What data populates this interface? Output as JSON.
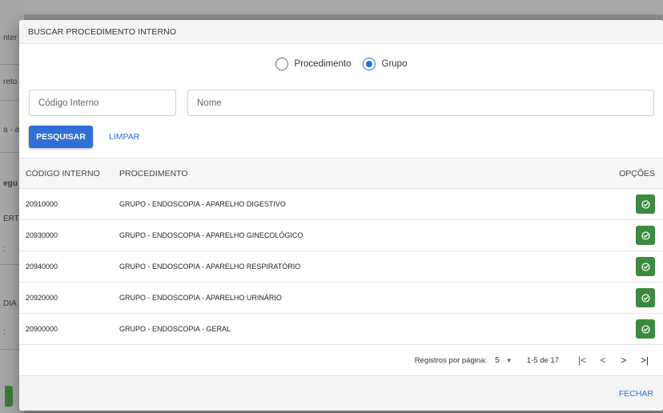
{
  "background": {
    "fragments": [
      "nter",
      "reto",
      "a - a",
      "egu",
      "ERT",
      ":",
      "DIA",
      ":"
    ]
  },
  "modal": {
    "title": "BUSCAR PROCEDIMENTO INTERNO",
    "radio": {
      "options": [
        {
          "label": "Procedimento",
          "checked": false
        },
        {
          "label": "Grupo",
          "checked": true
        }
      ]
    },
    "fields": {
      "codigo_placeholder": "Código Interno",
      "nome_placeholder": "Nome"
    },
    "buttons": {
      "pesquisar": "PESQUISAR",
      "limpar": "LIMPAR",
      "fechar": "FECHAR"
    },
    "table": {
      "headers": [
        "CÓDIGO INTERNO",
        "PROCEDIMENTO",
        "OPÇÕES"
      ],
      "rows": [
        {
          "codigo": "20910000",
          "procedimento": "GRUPO - ENDOSCOPIA - APARELHO DIGESTIVO"
        },
        {
          "codigo": "20930000",
          "procedimento": "GRUPO - ENDOSCOPIA - APARELHO GINECOLÓGICO"
        },
        {
          "codigo": "20940000",
          "procedimento": "GRUPO - ENDOSCOPIA - APARELHO RESPIRATÓRIO"
        },
        {
          "codigo": "20920000",
          "procedimento": "GRUPO - ENDOSCOPIA - APARELHO URINÁRIO"
        },
        {
          "codigo": "20900000",
          "procedimento": "GRUPO - ENDOSCOPIA - GERAL"
        }
      ],
      "option_icon": "select-check-icon"
    },
    "pagination": {
      "label": "Registros por página:",
      "per_page": "5",
      "range": "1-5 de 17",
      "nav_icons": [
        "first-page-icon",
        "prev-page-icon",
        "next-page-icon",
        "last-page-icon"
      ]
    }
  },
  "colors": {
    "primary": "#2f6fd6",
    "option_button": "#3b8a3e"
  }
}
